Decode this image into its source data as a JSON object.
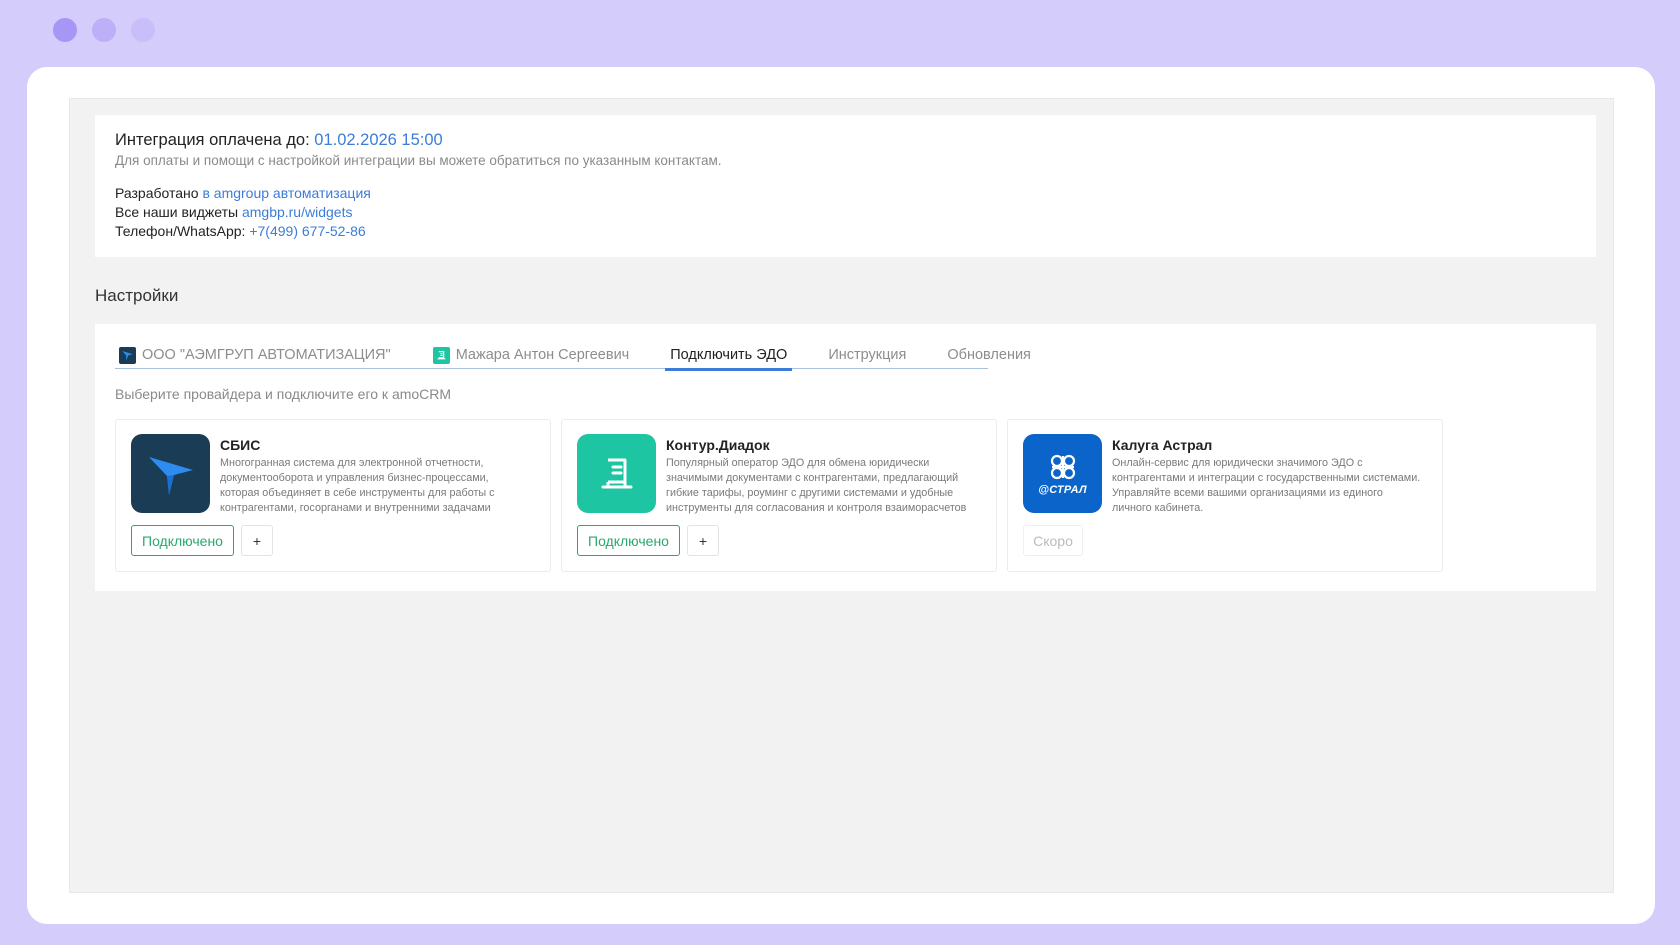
{
  "integration": {
    "paid_label": "Интеграция оплачена до:",
    "paid_date": "01.02.2026 15:00",
    "help_text": "Для оплаты и помощи с настройкой интеграции вы можете обратиться по указанным контактам.",
    "developed_label": "Разработано",
    "developed_link": "в amgroup автоматизация",
    "widgets_label": "Все наши виджеты",
    "widgets_link": "amgbp.ru/widgets",
    "phone_label": "Телефон/WhatsApp:",
    "phone_link": "+7(499) 677-52-86"
  },
  "settings": {
    "title": "Настройки",
    "tabs": [
      {
        "label": "ООО \"АЭМГРУП АВТОМАТИЗАЦИЯ\"",
        "icon": "sbis-icon"
      },
      {
        "label": "Мажара Антон Сергеевич",
        "icon": "diadoc-icon"
      },
      {
        "label": "Подключить ЭДО",
        "active": true
      },
      {
        "label": "Инструкция"
      },
      {
        "label": "Обновления"
      }
    ],
    "hint": "Выберите провайдера и подключите его к amoCRM"
  },
  "providers": [
    {
      "name": "СБИС",
      "description": "Многогранная система для электронной отчетности, документооборота и управления бизнес-процессами, которая объединяет в себе инструменты для работы с контрагентами, госорганами и внутренними задачами",
      "status_label": "Подключено",
      "plus_label": "+",
      "icon": "sbis-logo-icon"
    },
    {
      "name": "Контур.Диадок",
      "description": "Популярный оператор ЭДО для обмена юридически значимыми документами с контрагентами, предлагающий гибкие тарифы, роуминг с другими системами и удобные инструменты для согласования и контроля взаиморасчетов",
      "status_label": "Подключено",
      "plus_label": "+",
      "icon": "diadoc-logo-icon"
    },
    {
      "name": "Калуга Астрал",
      "description": "Онлайн-сервис для юридически значимого ЭДО с контрагентами и интеграции с государственными системами. Управляйте всеми вашими организациями из единого личного кабинета.",
      "status_label": "Скоро",
      "logo_text": "@СТРАЛ",
      "icon": "astral-logo-icon"
    }
  ],
  "colors": {
    "accent_blue": "#3b7dd8",
    "connected_green": "#2aa86c",
    "frame_purple": "#d4ccfb",
    "sbis_navy": "#1a3d55",
    "diadoc_teal": "#1dc5a3",
    "astral_blue": "#0b64c9"
  }
}
